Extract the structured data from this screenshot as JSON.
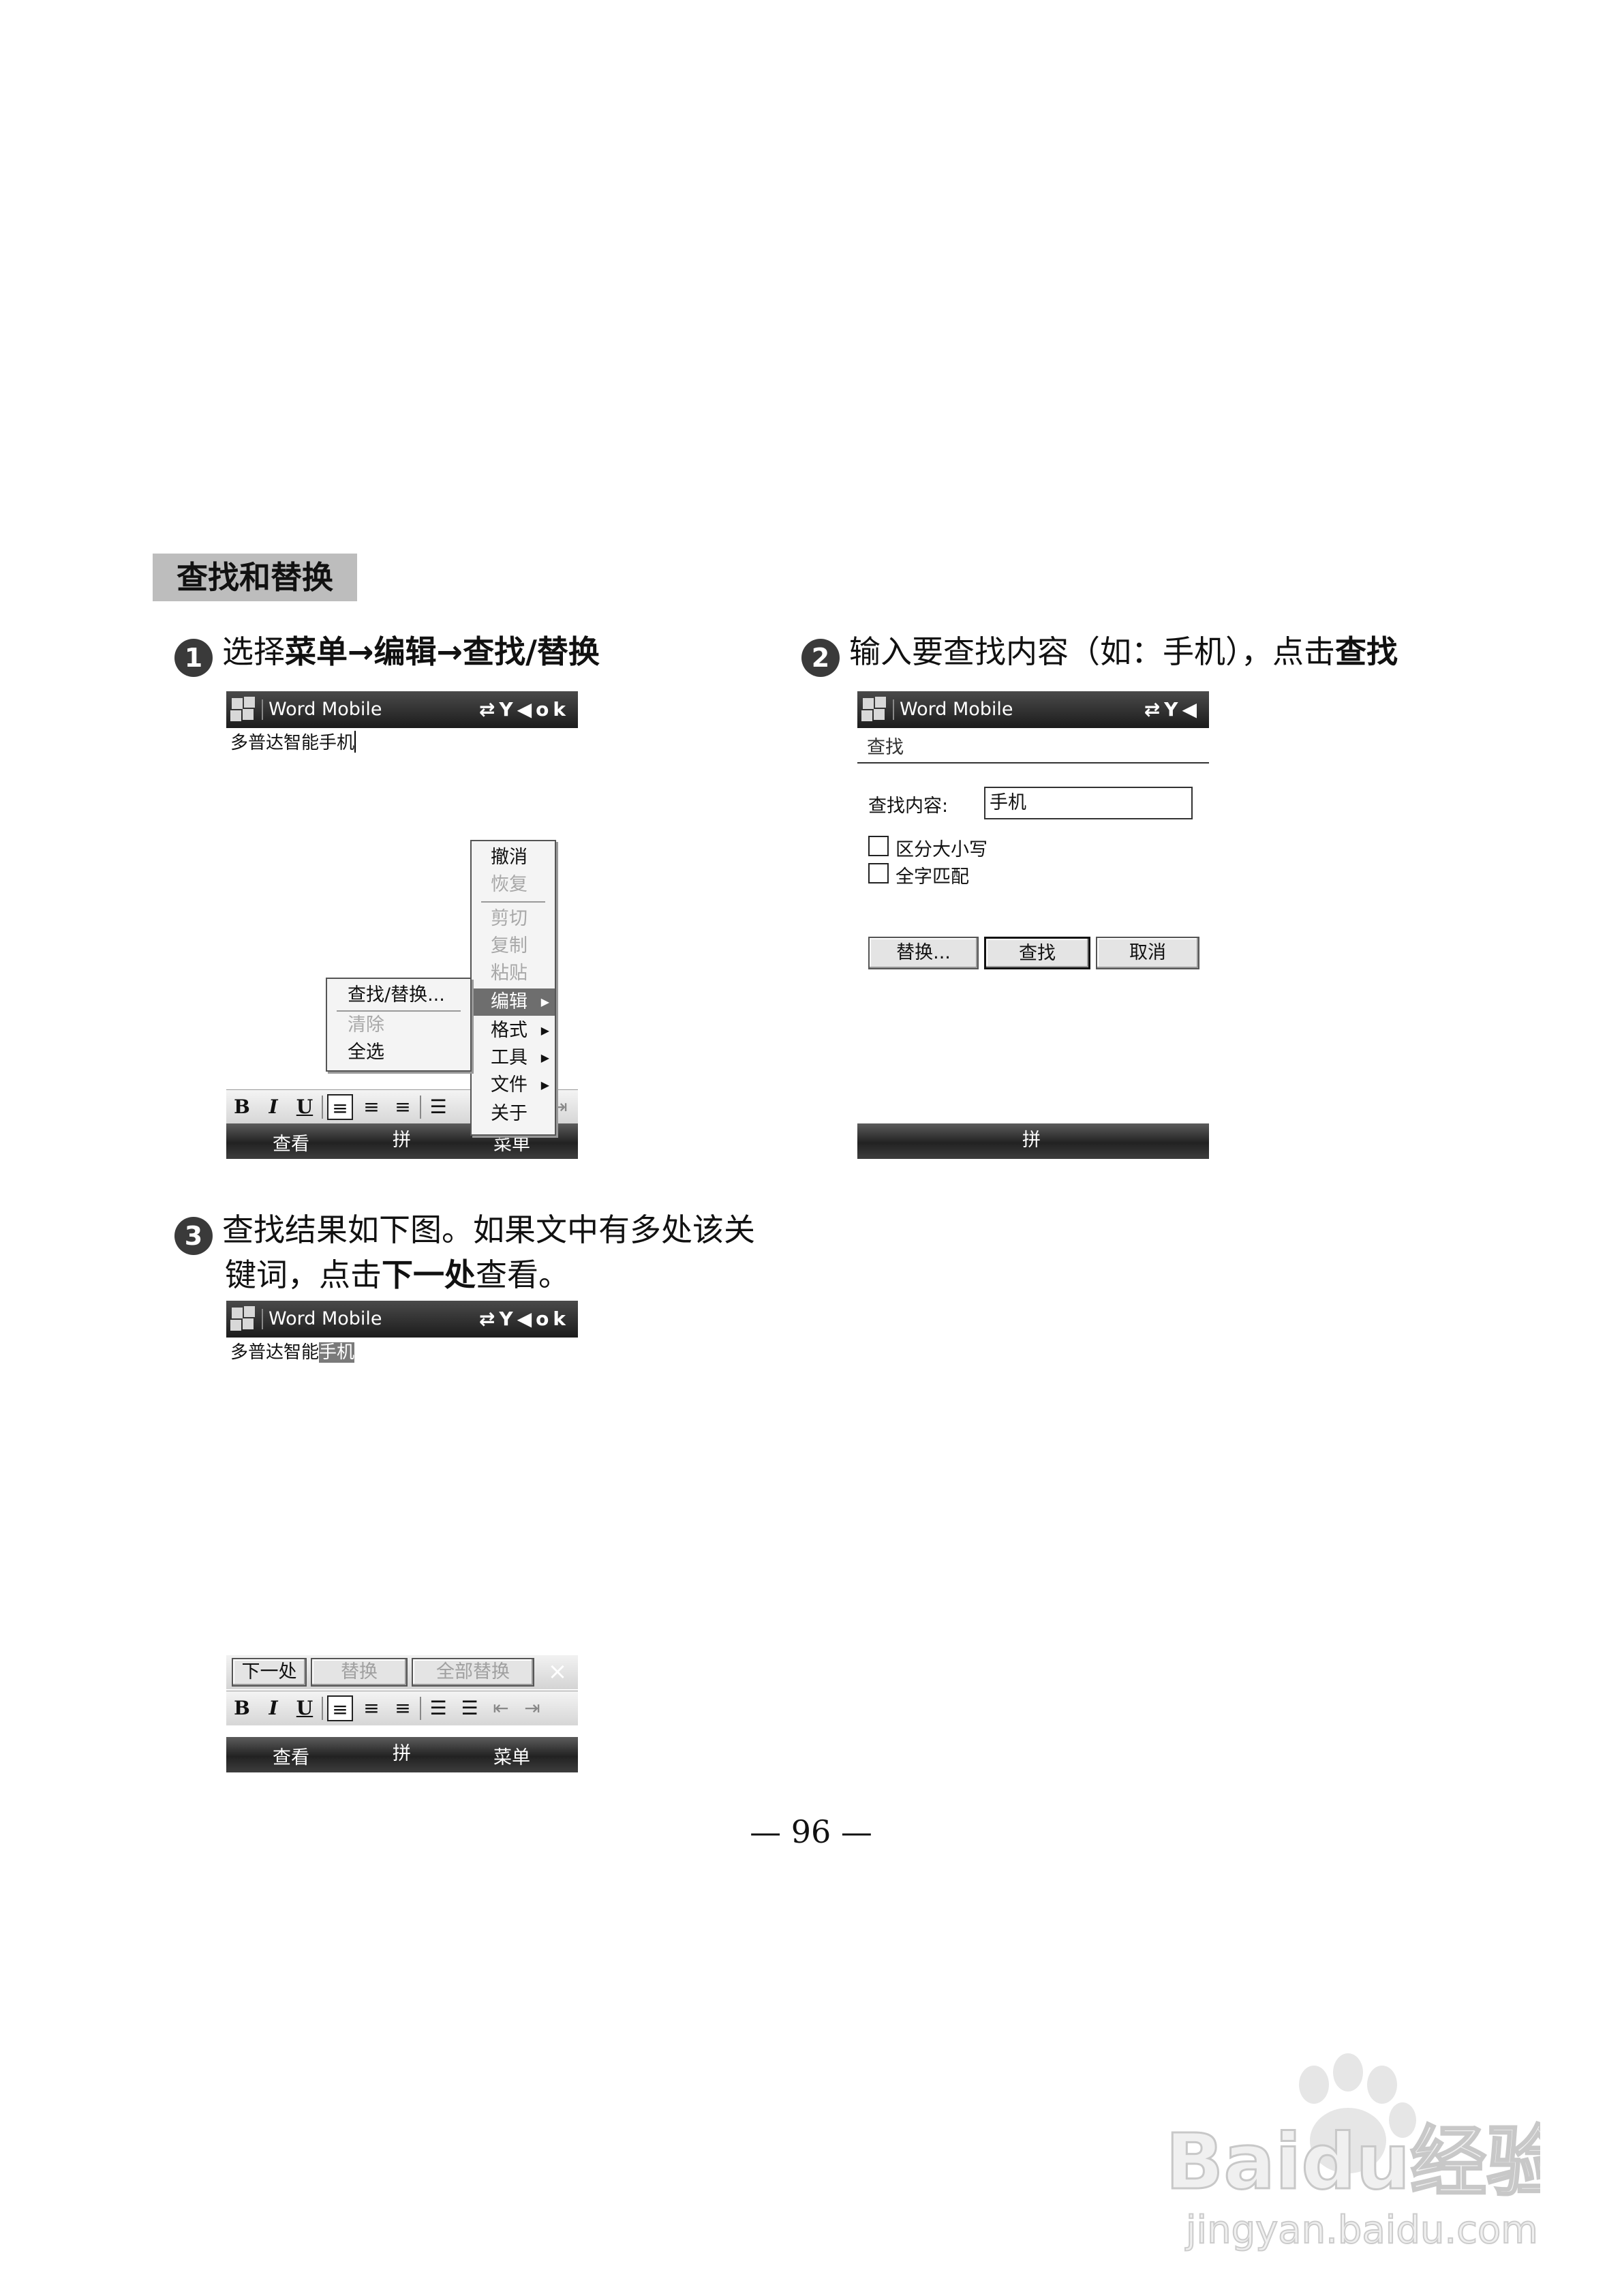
{
  "section_title": "查找和替换",
  "steps": [
    {
      "num": "1",
      "plain": "选择",
      "bold1": "菜单",
      "arrow": "→",
      "bold2": "编辑",
      "bold3": "查找/替换"
    },
    {
      "num": "2",
      "plain": "输入要查找内容（如：手机），点击",
      "bold": "查找"
    },
    {
      "num": "3",
      "line1": "查找结果如下图。如果文中有多处该关",
      "line2_plain": "键词，点击",
      "line2_bold": "下一处",
      "line2_end": "查看。"
    }
  ],
  "app": {
    "title": "Word Mobile",
    "status_ok": "ok",
    "doc_text": "多普达智能手机",
    "doc_text_prefix": "多普达智能",
    "doc_text_highlight": "手机"
  },
  "softkeys": {
    "left": "查看",
    "middle": "拼",
    "right": "菜单"
  },
  "format_buttons": {
    "bold": "B",
    "italic": "I",
    "underline": "U"
  },
  "main_menu": [
    {
      "label": "撤消",
      "enabled": true
    },
    {
      "label": "恢复",
      "enabled": false
    },
    {
      "label": "剪切",
      "enabled": false
    },
    {
      "label": "复制",
      "enabled": false
    },
    {
      "label": "粘贴",
      "enabled": false
    },
    {
      "label": "编辑",
      "enabled": true,
      "active": true
    },
    {
      "label": "格式",
      "enabled": true
    },
    {
      "label": "工具",
      "enabled": true
    },
    {
      "label": "文件",
      "enabled": true
    },
    {
      "label": "关于",
      "enabled": true
    }
  ],
  "edit_submenu": [
    {
      "label": "查找/替换...",
      "enabled": true
    },
    {
      "label": "清除",
      "enabled": false
    },
    {
      "label": "全选",
      "enabled": true
    }
  ],
  "find_dialog": {
    "title": "查找",
    "find_label": "查找内容:",
    "find_value": "手机",
    "match_case": "区分大小写",
    "whole_word": "全字匹配",
    "replace_button": "替换...",
    "find_button": "查找",
    "cancel_button": "取消"
  },
  "find_bar": {
    "next": "下一处",
    "replace": "替换",
    "replace_all": "全部替换",
    "close": "×"
  },
  "page_number": "— 96 —",
  "watermark": {
    "brand": "Baidu经验",
    "url": "jingyan.baidu.com"
  }
}
